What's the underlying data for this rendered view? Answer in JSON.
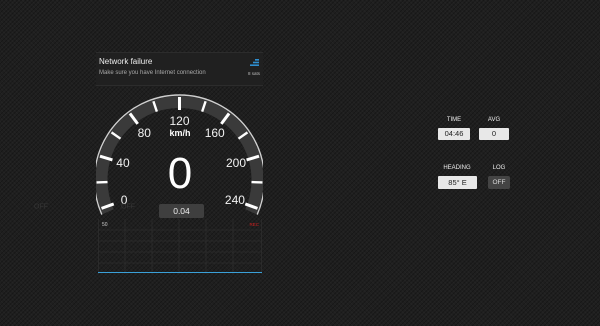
{
  "notification": {
    "title": "Network failure",
    "message": "Make sure you have Internet connection",
    "satellites": "8 sats",
    "icon": "signal-icon"
  },
  "gauge": {
    "ticks": [
      "0",
      "40",
      "80",
      "120",
      "160",
      "200",
      "240"
    ],
    "unit": "km/h",
    "speed": "0",
    "left_toggle": "OFF",
    "right_toggle": "OFF",
    "distance": "0.04"
  },
  "chart": {
    "max_label": "50",
    "rec_label": "REC"
  },
  "info": {
    "time_label": "TIME",
    "time_value": "04:46",
    "avg_label": "AVG",
    "avg_value": "0",
    "heading_label": "HEADING",
    "heading_value": "85° E",
    "log_label": "LOG",
    "log_value": "OFF"
  },
  "colors": {
    "background": "#1f1f1f",
    "chart_line": "#3aa0d8",
    "rec": "#d02020"
  }
}
